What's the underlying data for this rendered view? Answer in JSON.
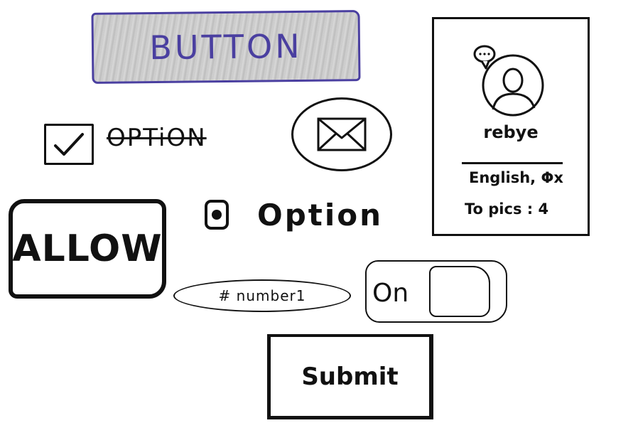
{
  "button": {
    "label": "BUTTON"
  },
  "checkbox": {
    "label": "OPTiON",
    "checked": true
  },
  "mail": {
    "icon": "mail-icon"
  },
  "profile": {
    "name": "rebye",
    "languages": "English, Φx",
    "topics": "To pics : 4",
    "avatar_icon": "user-avatar-icon",
    "badge_icon": "chat-bubble-icon"
  },
  "allow": {
    "label": "ALLOW"
  },
  "radio": {
    "label": "Option",
    "selected": true
  },
  "text_input": {
    "value": "# number1"
  },
  "toggle": {
    "label": "On",
    "state": "on"
  },
  "submit": {
    "label": "Submit"
  },
  "colors": {
    "accent": "#4a3fa0",
    "ink": "#111111",
    "shade": "#c9c9c9"
  }
}
